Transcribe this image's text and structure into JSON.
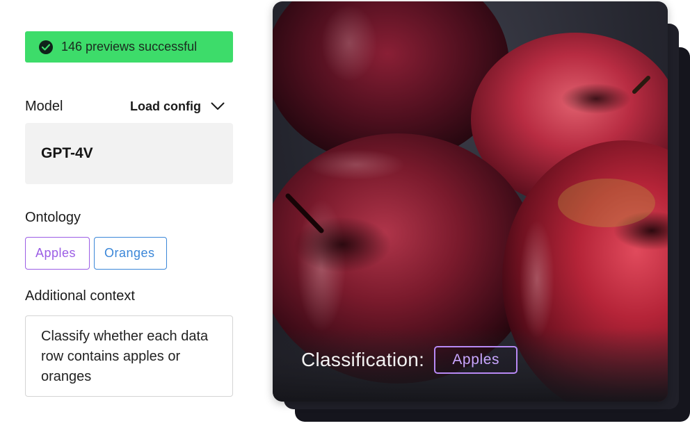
{
  "status": {
    "message": "146 previews successful",
    "color": "#3ddc6a"
  },
  "model": {
    "label": "Model",
    "load_config_label": "Load config",
    "value": "GPT-4V"
  },
  "ontology": {
    "label": "Ontology",
    "chips": [
      {
        "label": "Apples",
        "color": "#9b5de5"
      },
      {
        "label": "Oranges",
        "color": "#3a86d8"
      }
    ]
  },
  "context": {
    "label": "Additional context",
    "value": "Classify whether each data row contains apples or oranges"
  },
  "preview": {
    "classification_label": "Classification:",
    "classification_value": "Apples"
  }
}
